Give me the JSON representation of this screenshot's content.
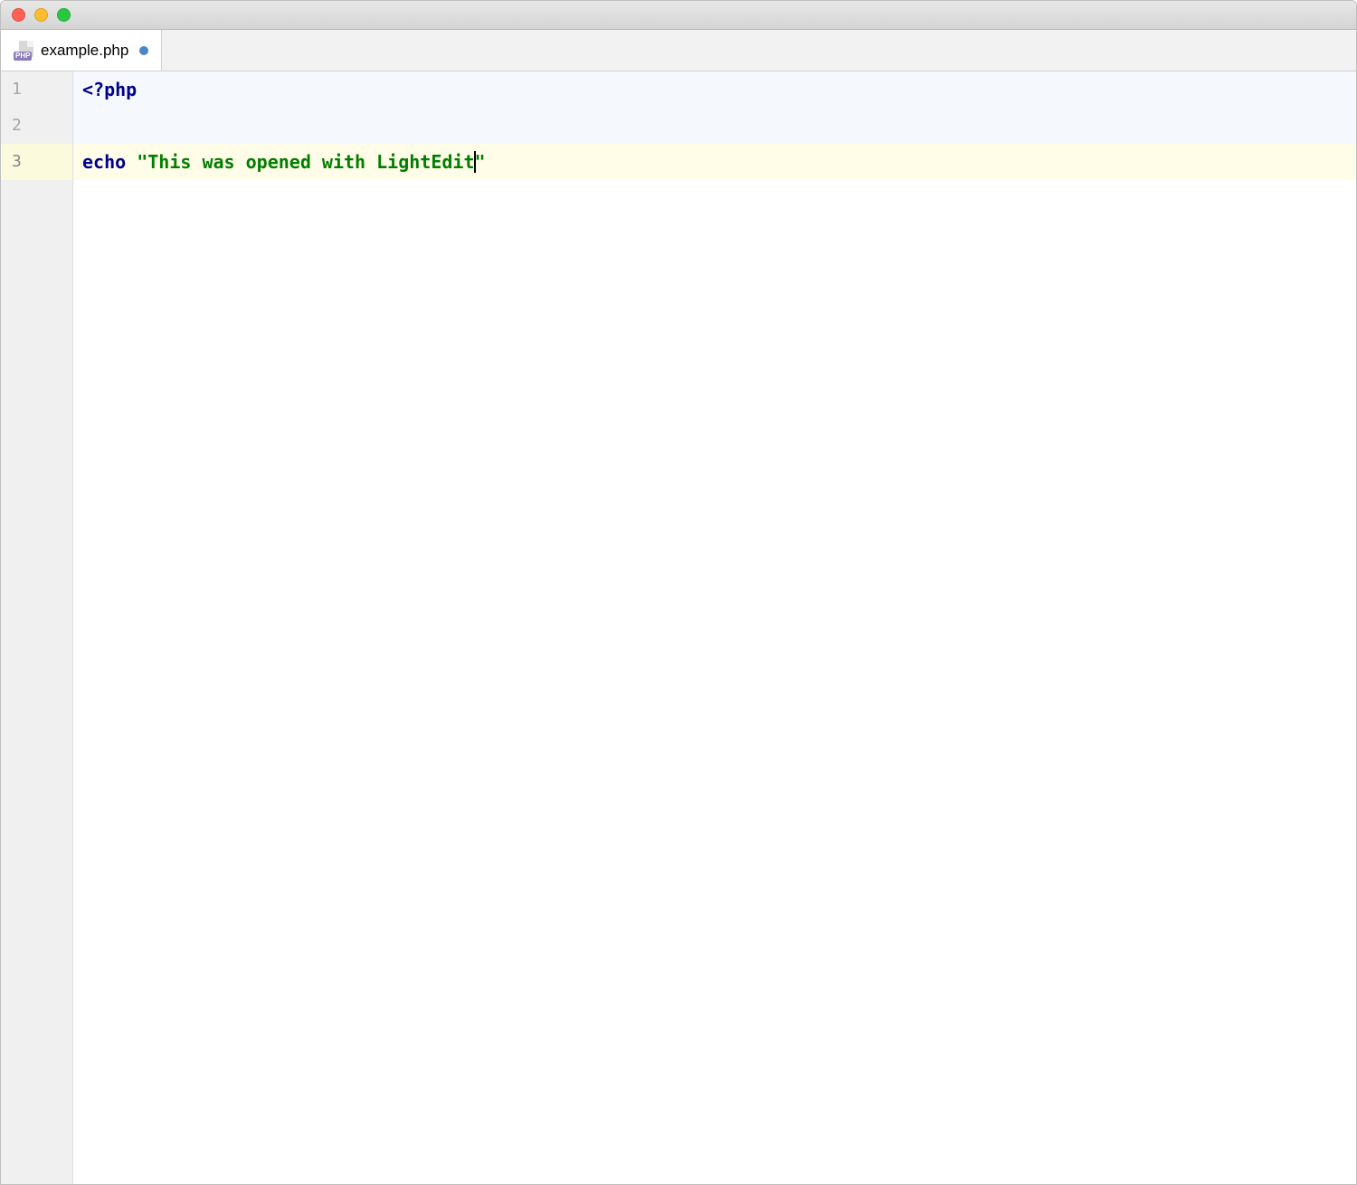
{
  "window": {
    "tab": {
      "filename": "example.php",
      "file_type_badge": "PHP",
      "modified": true
    }
  },
  "editor": {
    "gutter_numbers": [
      "1",
      "2",
      "3"
    ],
    "active_line_index": 2,
    "lines": [
      {
        "bg": "light",
        "tokens": [
          {
            "text": "<?php",
            "cls": "tk-tag"
          }
        ]
      },
      {
        "bg": "light",
        "tokens": []
      },
      {
        "bg": "active",
        "tokens": [
          {
            "text": "echo ",
            "cls": "tk-keyword"
          },
          {
            "text": "\"This was opened with LightEdit",
            "cls": "tk-string"
          },
          {
            "caret": true
          },
          {
            "text": "\"",
            "cls": "tk-string"
          }
        ]
      }
    ]
  }
}
